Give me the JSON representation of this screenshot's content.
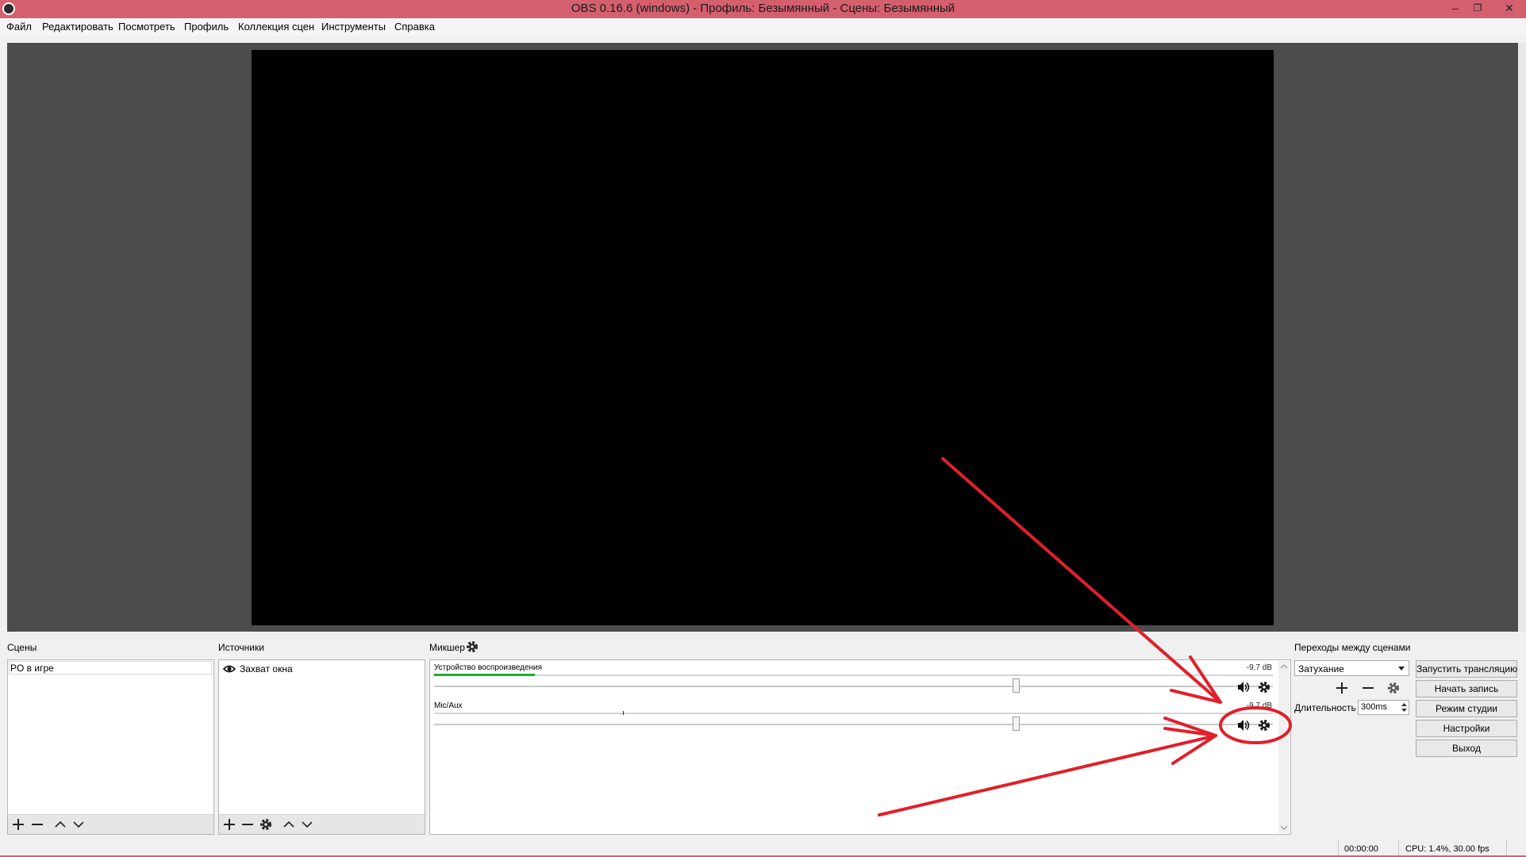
{
  "window": {
    "title": "OBS 0.16.6 (windows) - Профиль: Безымянный - Сцены: Безымянный",
    "controls": {
      "minimize": "–",
      "maximize": "❐",
      "close": "✕"
    }
  },
  "menu": [
    "Файл",
    "Редактировать",
    "Посмотреть",
    "Профиль",
    "Коллекция сцен",
    "Инструменты",
    "Справка"
  ],
  "scenes": {
    "label": "Сцены",
    "items": [
      "PO в игре"
    ]
  },
  "sources": {
    "label": "Источники",
    "items": [
      {
        "name": "Захват окна",
        "visible": true
      }
    ]
  },
  "mixer": {
    "label": "Микшер",
    "channels": [
      {
        "name": "Устройство воспроизведения",
        "db": "-9.7 dB",
        "level": 0.12,
        "volume": 0.69
      },
      {
        "name": "Mic/Aux",
        "db": "-9.7 dB",
        "level": 0.0,
        "volume": 0.69
      }
    ]
  },
  "transitions": {
    "label": "Переходы между сценами",
    "selected": "Затухание",
    "duration_label": "Длительность",
    "duration_value": "300ms"
  },
  "controls": {
    "start_stream": "Запустить трансляцию",
    "start_record": "Начать запись",
    "studio_mode": "Режим студии",
    "settings": "Настройки",
    "exit": "Выход"
  },
  "status": {
    "time": "00:00:00",
    "cpu": "CPU: 1.4%, 30.00 fps"
  },
  "colors": {
    "titlebar": "#d4606e",
    "preview_bg": "#4c4c4c",
    "annotation": "#e0202a",
    "meter": "#1fae2f"
  }
}
